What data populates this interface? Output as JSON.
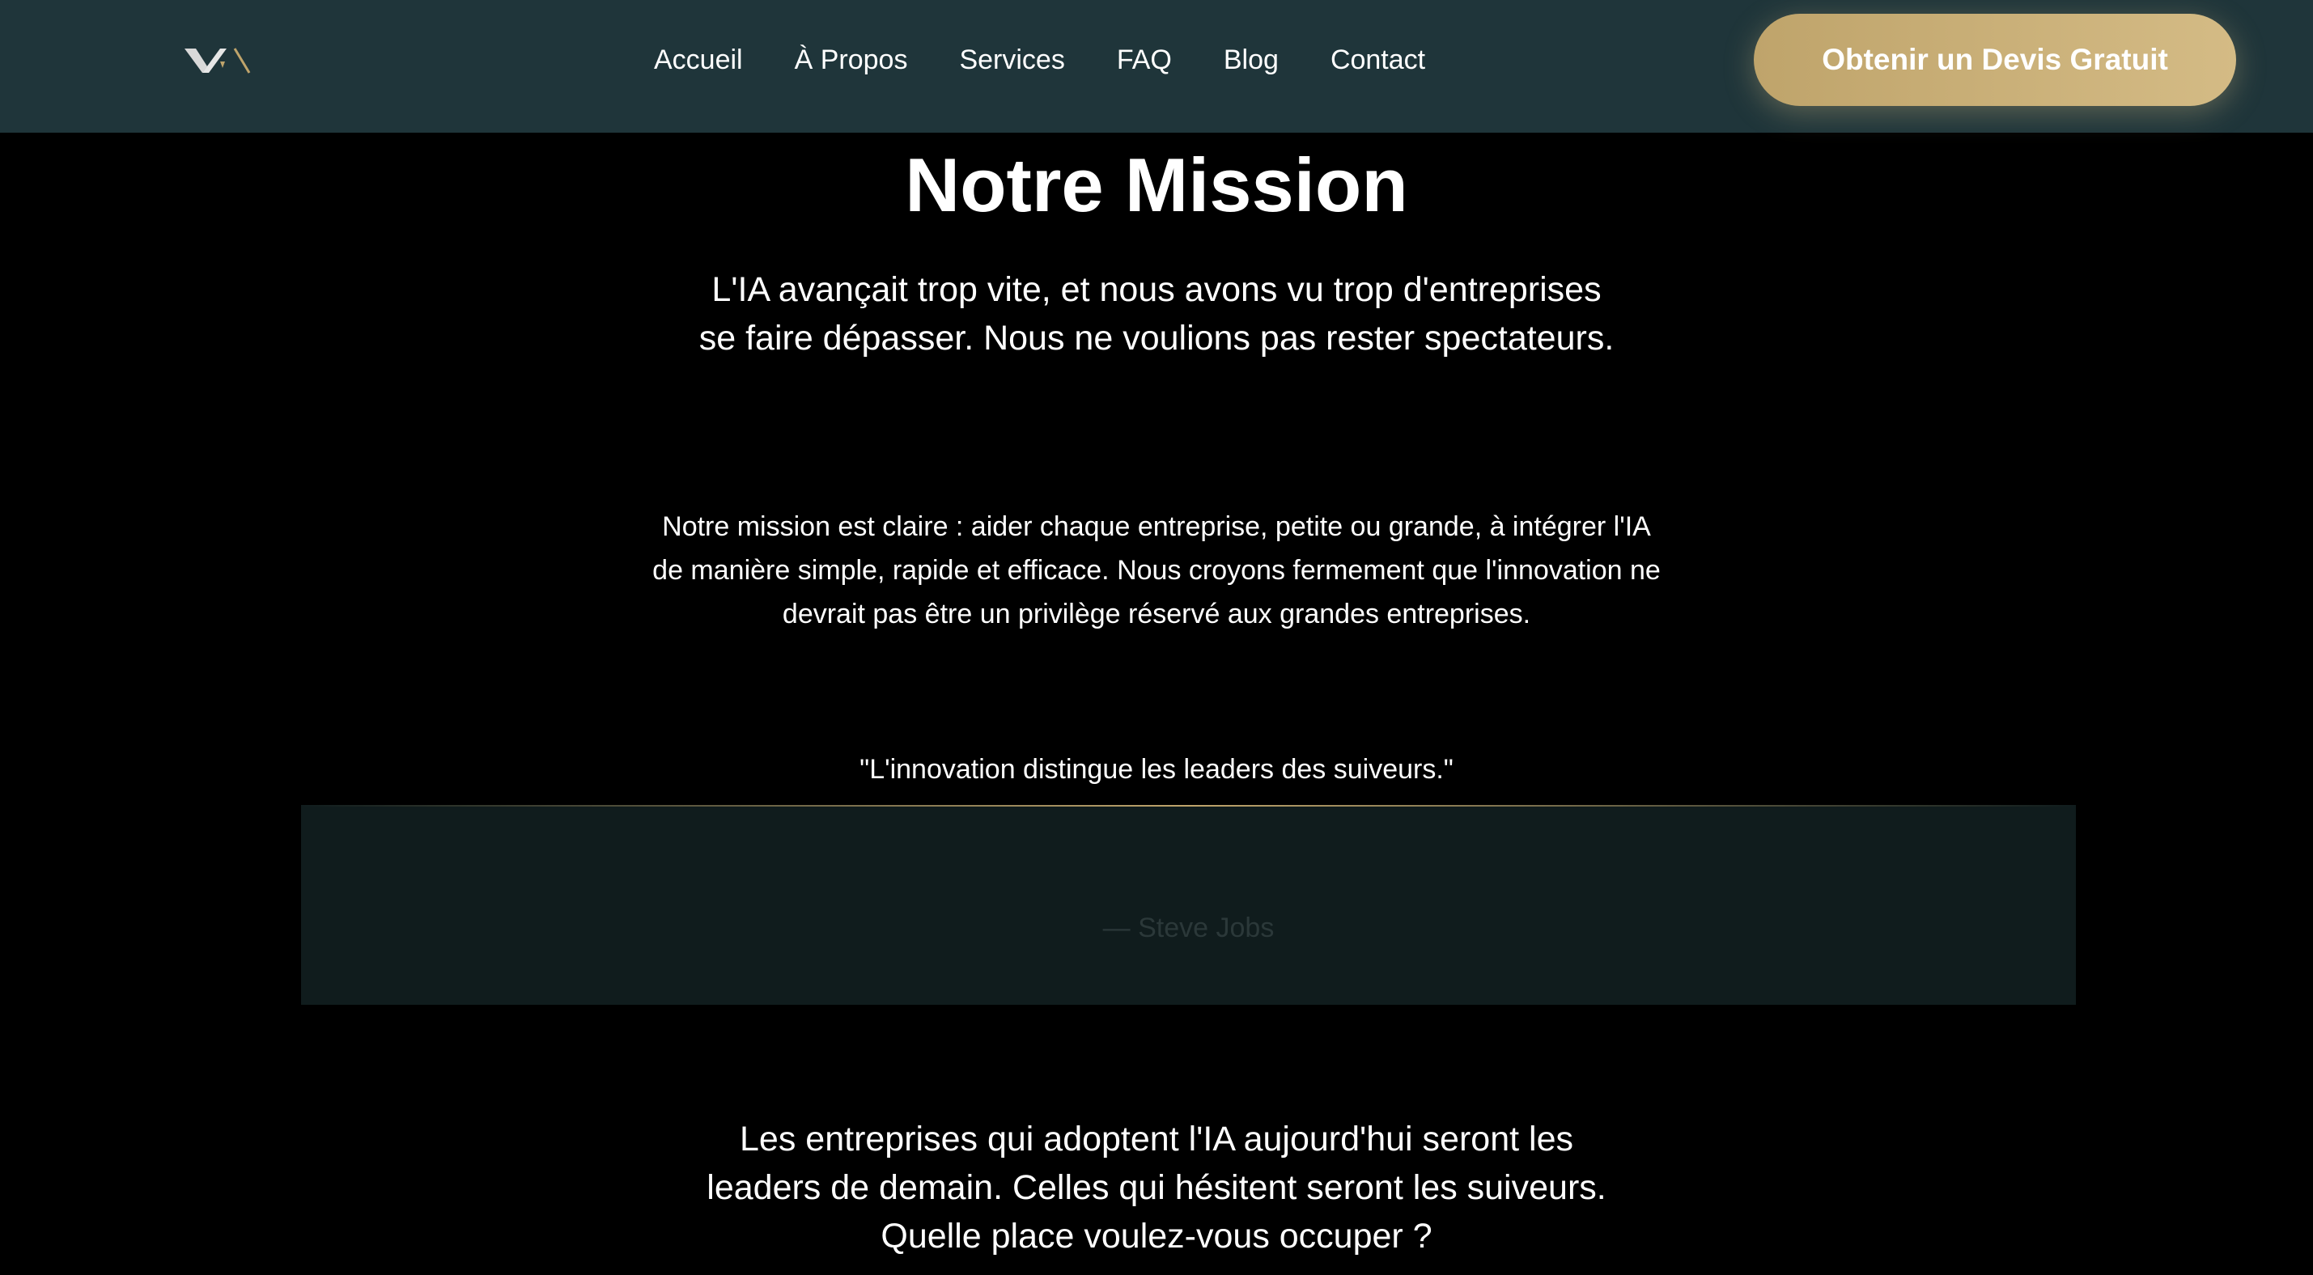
{
  "nav": {
    "logo_icon": "brand-logo-icon",
    "links": [
      "Accueil",
      "À Propos",
      "Services",
      "FAQ",
      "Blog",
      "Contact"
    ],
    "cta_label": "Obtenir un Devis Gratuit"
  },
  "mission": {
    "title": "Notre Mission",
    "subtitle": "L'IA avançait trop vite, et nous avons vu trop d'entreprises se faire dépasser. Nous ne voulions pas rester spectateurs.",
    "body": "Notre mission est claire : aider chaque entreprise, petite ou grande, à intégrer l'IA de manière simple, rapide et efficace. Nous croyons fermement que l'innovation ne devrait pas être un privilège réservé aux grandes entreprises.",
    "quote": "\"L'innovation distingue les leaders des suiveurs.\"",
    "quote_author": "— Steve Jobs",
    "closing": "Les entreprises qui adoptent l'IA aujourd'hui seront les leaders de demain. Celles qui hésitent seront les suiveurs. Quelle place voulez-vous occuper ?"
  },
  "colors": {
    "nav_background": "#1f353a",
    "accent_gold": "#bfa46b",
    "page_background": "#000000",
    "quote_box_background": "#101c1d"
  }
}
